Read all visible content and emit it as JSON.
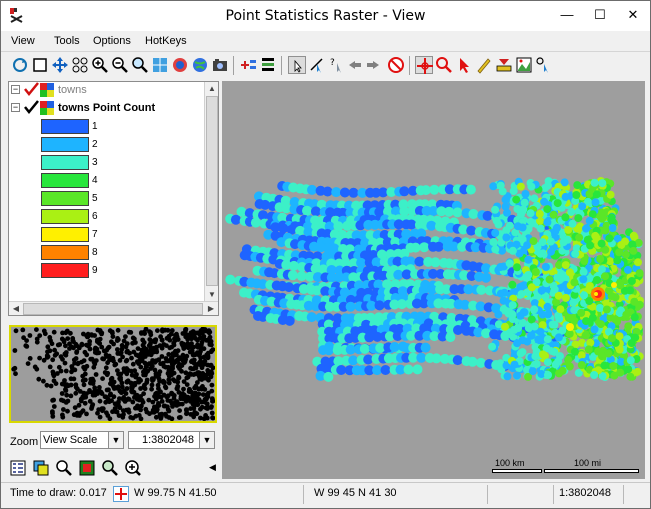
{
  "window": {
    "title": "Point Statistics Raster - View",
    "minimize_glyph": "—",
    "maximize_glyph": "☐",
    "close_glyph": "✕"
  },
  "menu": {
    "items": [
      "View",
      "Tools",
      "Options",
      "HotKeys"
    ]
  },
  "toolbar": {
    "icons": [
      "redraw-icon",
      "full-view-icon",
      "pan-icon",
      "zoom-box-icon",
      "zoom-in-icon",
      "zoom-out-icon",
      "zoom-to-layer-icon",
      "zoom-selected-icon",
      "multi-layer-icon",
      "globe-icon",
      "snapshot-icon",
      "add-layer-icon",
      "layer-manager-icon",
      "select-icon",
      "measure-icon",
      "help-cursor-icon",
      "back-icon",
      "forward-icon",
      "stop-icon",
      "crosshair-icon",
      "zoom-target-icon",
      "pointer-icon",
      "pencil-icon",
      "edit-ruler-icon",
      "image-icon",
      "sketch-icon"
    ]
  },
  "legend": {
    "layers": [
      {
        "name": "towns",
        "checked": true,
        "expanded": true
      },
      {
        "name": "towns Point Count",
        "checked": true,
        "expanded": true
      }
    ],
    "classes": [
      {
        "label": "1",
        "color": "#1e64ff"
      },
      {
        "label": "2",
        "color": "#1eb4ff"
      },
      {
        "label": "3",
        "color": "#3cf0c8"
      },
      {
        "label": "4",
        "color": "#28e63c"
      },
      {
        "label": "5",
        "color": "#5ae628"
      },
      {
        "label": "6",
        "color": "#aaf014"
      },
      {
        "label": "7",
        "color": "#fff000"
      },
      {
        "label": "8",
        "color": "#ff8200"
      },
      {
        "label": "9",
        "color": "#ff1e1e"
      }
    ]
  },
  "zoom": {
    "label": "Zoom",
    "mode": "View Scale",
    "scale": "1:3802048"
  },
  "bottom_toolbar": {
    "icons": [
      "legend-icon",
      "layers-icon",
      "search-icon",
      "locator-icon",
      "zoom-overview-icon",
      "zoom-extent-icon"
    ]
  },
  "map": {
    "scale_km": "100 km",
    "scale_mi": "100 mi"
  },
  "status": {
    "time_to_draw": "Time to draw: 0.017",
    "coord1": "W 99.75  N 41.50",
    "coord2": "W 99 45  N 41 30",
    "scale": "1:3802048"
  },
  "colors": {
    "map_background": "#9e9e9e",
    "overview_border": "#d8d800"
  }
}
